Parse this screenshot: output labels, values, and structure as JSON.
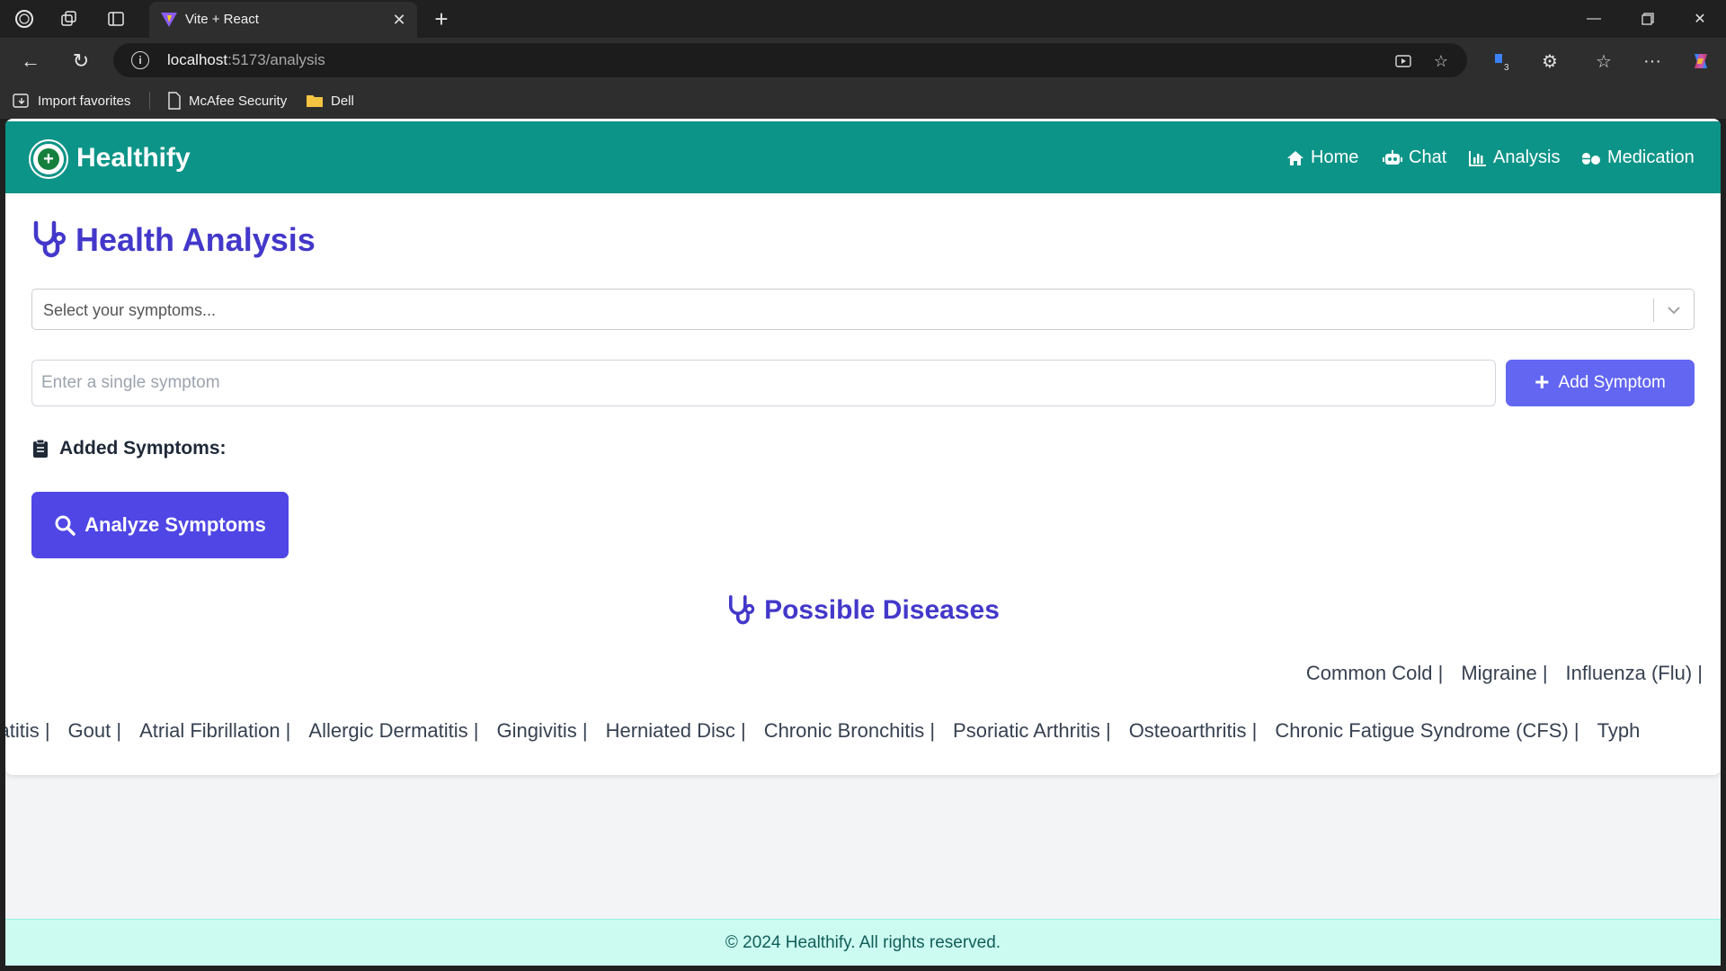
{
  "browser": {
    "tab_title": "Vite + React",
    "url_host": "localhost",
    "url_path": ":5173/analysis",
    "extension_badge": "3",
    "favorites": [
      {
        "label": "Import favorites",
        "icon": "import-icon"
      },
      {
        "label": "McAfee Security",
        "icon": "page-icon"
      },
      {
        "label": "Dell",
        "icon": "folder-icon"
      }
    ]
  },
  "app": {
    "brand": "Healthify",
    "nav": [
      {
        "label": "Home",
        "icon": "home-icon"
      },
      {
        "label": "Chat",
        "icon": "robot-icon"
      },
      {
        "label": "Analysis",
        "icon": "chart-icon"
      },
      {
        "label": "Medication",
        "icon": "pills-icon"
      }
    ],
    "colors": {
      "nav_bg": "#0d9488",
      "accent": "#4338ca",
      "button": "#4f46e5",
      "add_button": "#6366f1",
      "footer_bg": "#ccfbf1"
    }
  },
  "analysis": {
    "title": "Health Analysis",
    "select_placeholder": "Select your symptoms...",
    "input_placeholder": "Enter a single symptom",
    "add_button": "Add Symptom",
    "added_label": "Added Symptoms:",
    "analyze_button": "Analyze Symptoms",
    "diseases_title": "Possible Diseases",
    "diseases_row1": [
      "Common Cold |",
      "Migraine |",
      "Influenza (Flu) |"
    ],
    "diseases_row2": [
      "epatitis |",
      "Gout |",
      "Atrial Fibrillation |",
      "Allergic Dermatitis |",
      "Gingivitis |",
      "Herniated Disc |",
      "Chronic Bronchitis |",
      "Psoriatic Arthritis |",
      "Osteoarthritis |",
      "Chronic Fatigue Syndrome (CFS) |",
      "Typh"
    ]
  },
  "footer": {
    "text": "© 2024 Healthify. All rights reserved."
  }
}
